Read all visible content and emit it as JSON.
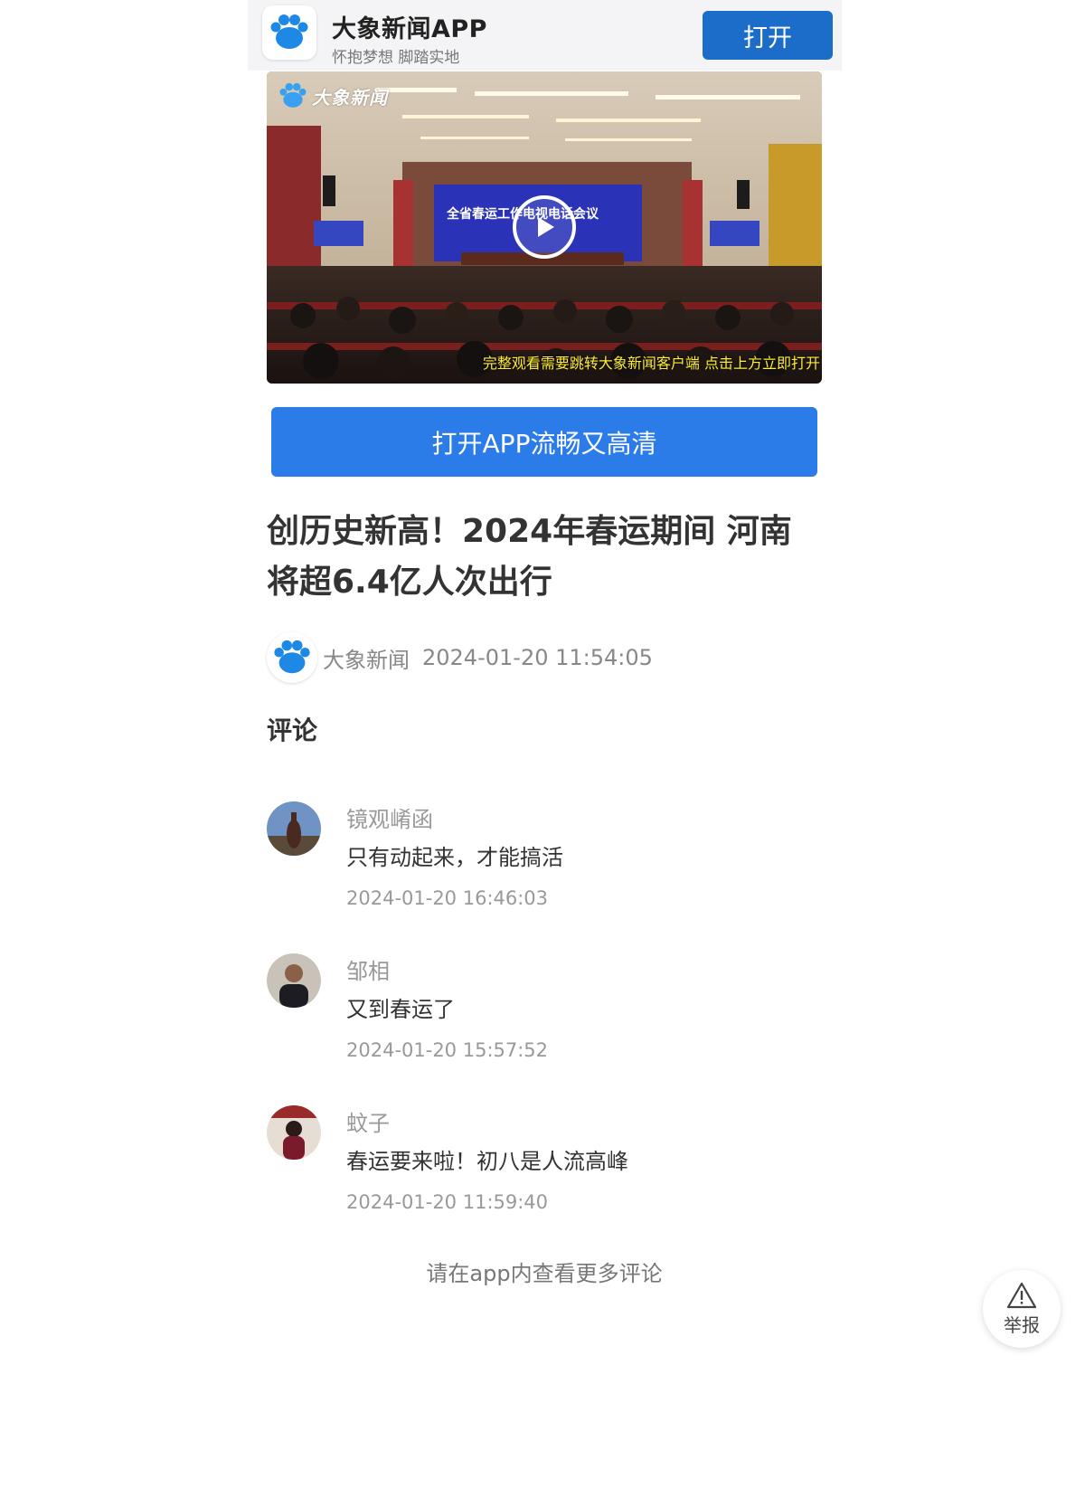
{
  "app_banner": {
    "logo_icon": "paw-logo-icon",
    "name": "大象新闻APP",
    "slogan": "怀抱梦想 脚踏实地",
    "open_label": "打开"
  },
  "video": {
    "logo_text": "大象新闻",
    "play_icon": "play-icon",
    "tip": "完整观看需要跳转大象新闻客户端 点击上方立即打开"
  },
  "cta": {
    "label": "打开APP流畅又高清"
  },
  "article": {
    "title": "创历史新高！2024年春运期间 河南将超6.4亿人次出行",
    "source": "大象新闻",
    "published": "2024-01-20 11:54:05"
  },
  "comments": {
    "title": "评论",
    "items": [
      {
        "name": "镜观崤函",
        "text": "只有动起来，才能搞活",
        "time": "2024-01-20 16:46:03"
      },
      {
        "name": "邹相",
        "text": "又到春运了",
        "time": "2024-01-20 15:57:52"
      },
      {
        "name": "蚊子",
        "text": "春运要来啦！初八是人流高峰",
        "time": "2024-01-20 11:59:40"
      }
    ],
    "more": "请在app内查看更多评论"
  },
  "report": {
    "icon": "warning-icon",
    "label": "举报"
  },
  "colors": {
    "primary_button": "#1b6dc9",
    "cta_button": "#2b7ce9",
    "logo_blue": "#1e88e5",
    "video_tip": "#ffee33"
  }
}
